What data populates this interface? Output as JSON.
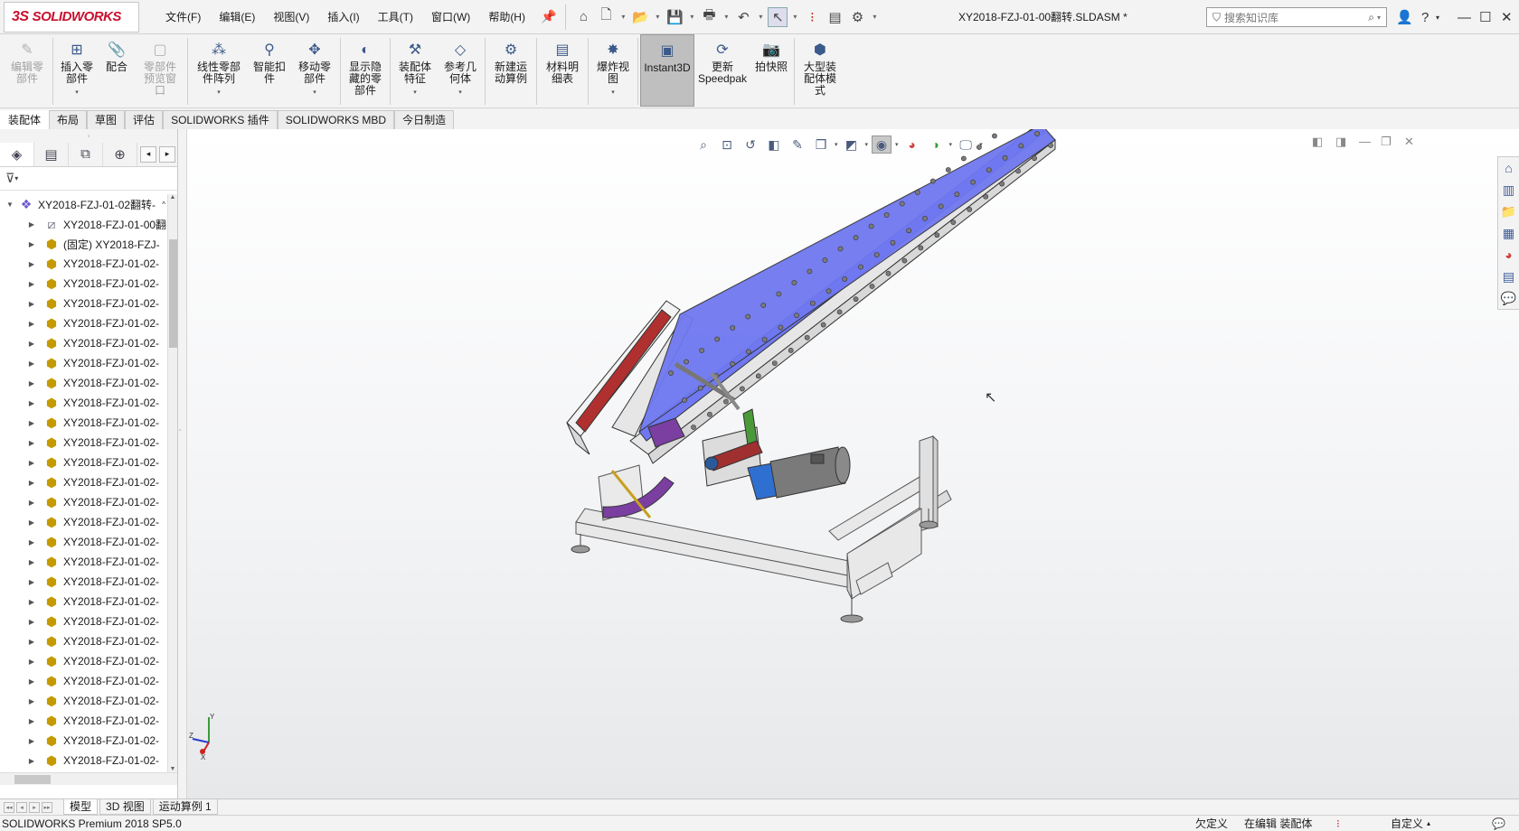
{
  "app": {
    "logo_text": "SOLIDWORKS",
    "logo_mark": "3S"
  },
  "menu": [
    "文件(F)",
    "编辑(E)",
    "视图(V)",
    "插入(I)",
    "工具(T)",
    "窗口(W)",
    "帮助(H)"
  ],
  "window": {
    "title": "XY2018-FZJ-01-00翻转.SLDASM *"
  },
  "search": {
    "placeholder": "搜索知识库"
  },
  "commands": [
    {
      "label": "编辑零\n部件",
      "icon": "edit-component-icon",
      "disabled": true
    },
    {
      "label": "插入零\n部件",
      "icon": "insert-component-icon",
      "dropdown": true
    },
    {
      "label": "配合",
      "icon": "mate-icon"
    },
    {
      "label": "零部件\n预览窗\n口",
      "icon": "component-preview-icon",
      "disabled": true
    },
    {
      "label": "线性零部\n件阵列",
      "icon": "linear-pattern-icon",
      "dropdown": true
    },
    {
      "label": "智能扣\n件",
      "icon": "smart-fasteners-icon"
    },
    {
      "label": "移动零\n部件",
      "icon": "move-component-icon",
      "dropdown": true
    },
    {
      "label": "显示隐\n藏的零\n部件",
      "icon": "show-hidden-icon"
    },
    {
      "label": "装配体\n特征",
      "icon": "assembly-features-icon",
      "dropdown": true
    },
    {
      "label": "参考几\n何体",
      "icon": "reference-geometry-icon",
      "dropdown": true
    },
    {
      "label": "新建运\n动算例",
      "icon": "new-motion-study-icon"
    },
    {
      "label": "材料明\n细表",
      "icon": "bom-icon"
    },
    {
      "label": "爆炸视\n图",
      "icon": "exploded-view-icon",
      "dropdown": true
    },
    {
      "label": "Instant3D",
      "icon": "instant3d-icon",
      "active": true
    },
    {
      "label": "更新\nSpeedpak",
      "icon": "speedpak-icon"
    },
    {
      "label": "拍快照",
      "icon": "snapshot-icon"
    },
    {
      "label": "大型装\n配体模\n式",
      "icon": "large-assembly-icon"
    }
  ],
  "cm_tabs": [
    "装配体",
    "布局",
    "草图",
    "评估",
    "SOLIDWORKS 插件",
    "SOLIDWORKS MBD",
    "今日制造"
  ],
  "tree": {
    "root": "XY2018-FZJ-01-02翻转-",
    "items": [
      {
        "label": "XY2018-FZJ-01-00翻",
        "type": "mate"
      },
      {
        "label": "(固定) XY2018-FZJ-",
        "type": "part"
      },
      {
        "label": "XY2018-FZJ-01-02-",
        "type": "part"
      },
      {
        "label": "XY2018-FZJ-01-02-",
        "type": "part"
      },
      {
        "label": "XY2018-FZJ-01-02-",
        "type": "part"
      },
      {
        "label": "XY2018-FZJ-01-02-",
        "type": "part"
      },
      {
        "label": "XY2018-FZJ-01-02-",
        "type": "part"
      },
      {
        "label": "XY2018-FZJ-01-02-",
        "type": "part"
      },
      {
        "label": "XY2018-FZJ-01-02-",
        "type": "part"
      },
      {
        "label": "XY2018-FZJ-01-02-",
        "type": "part"
      },
      {
        "label": "XY2018-FZJ-01-02-",
        "type": "part"
      },
      {
        "label": "XY2018-FZJ-01-02-",
        "type": "part"
      },
      {
        "label": "XY2018-FZJ-01-02-",
        "type": "part"
      },
      {
        "label": "XY2018-FZJ-01-02-",
        "type": "part"
      },
      {
        "label": "XY2018-FZJ-01-02-",
        "type": "part"
      },
      {
        "label": "XY2018-FZJ-01-02-",
        "type": "part"
      },
      {
        "label": "XY2018-FZJ-01-02-",
        "type": "part"
      },
      {
        "label": "XY2018-FZJ-01-02-",
        "type": "part"
      },
      {
        "label": "XY2018-FZJ-01-02-",
        "type": "part"
      },
      {
        "label": "XY2018-FZJ-01-02-",
        "type": "part"
      },
      {
        "label": "XY2018-FZJ-01-02-",
        "type": "part"
      },
      {
        "label": "XY2018-FZJ-01-02-",
        "type": "part"
      },
      {
        "label": "XY2018-FZJ-01-02-",
        "type": "part"
      },
      {
        "label": "XY2018-FZJ-01-02-",
        "type": "part"
      },
      {
        "label": "XY2018-FZJ-01-02-",
        "type": "part"
      },
      {
        "label": "XY2018-FZJ-01-02-",
        "type": "part"
      },
      {
        "label": "XY2018-FZJ-01-02-",
        "type": "part"
      },
      {
        "label": "XY2018-FZJ-01-02-",
        "type": "part"
      },
      {
        "label": "XY2018-FZJ-01-02-",
        "type": "part"
      }
    ]
  },
  "triad": {
    "x": "X",
    "y": "Y",
    "z": "Z"
  },
  "bottom_tabs": [
    "模型",
    "3D 视图",
    "运动算例 1"
  ],
  "status": {
    "left": "SOLIDWORKS Premium 2018 SP5.0",
    "underdefined": "欠定义",
    "editing": "在编辑 装配体",
    "custom": "自定义"
  },
  "colors": {
    "deck": "#6f78f0",
    "frame": "#e8e8e8",
    "accent_red": "#b03030",
    "link_purple": "#7a3fa0",
    "motor_blue": "#2f6fd0"
  }
}
